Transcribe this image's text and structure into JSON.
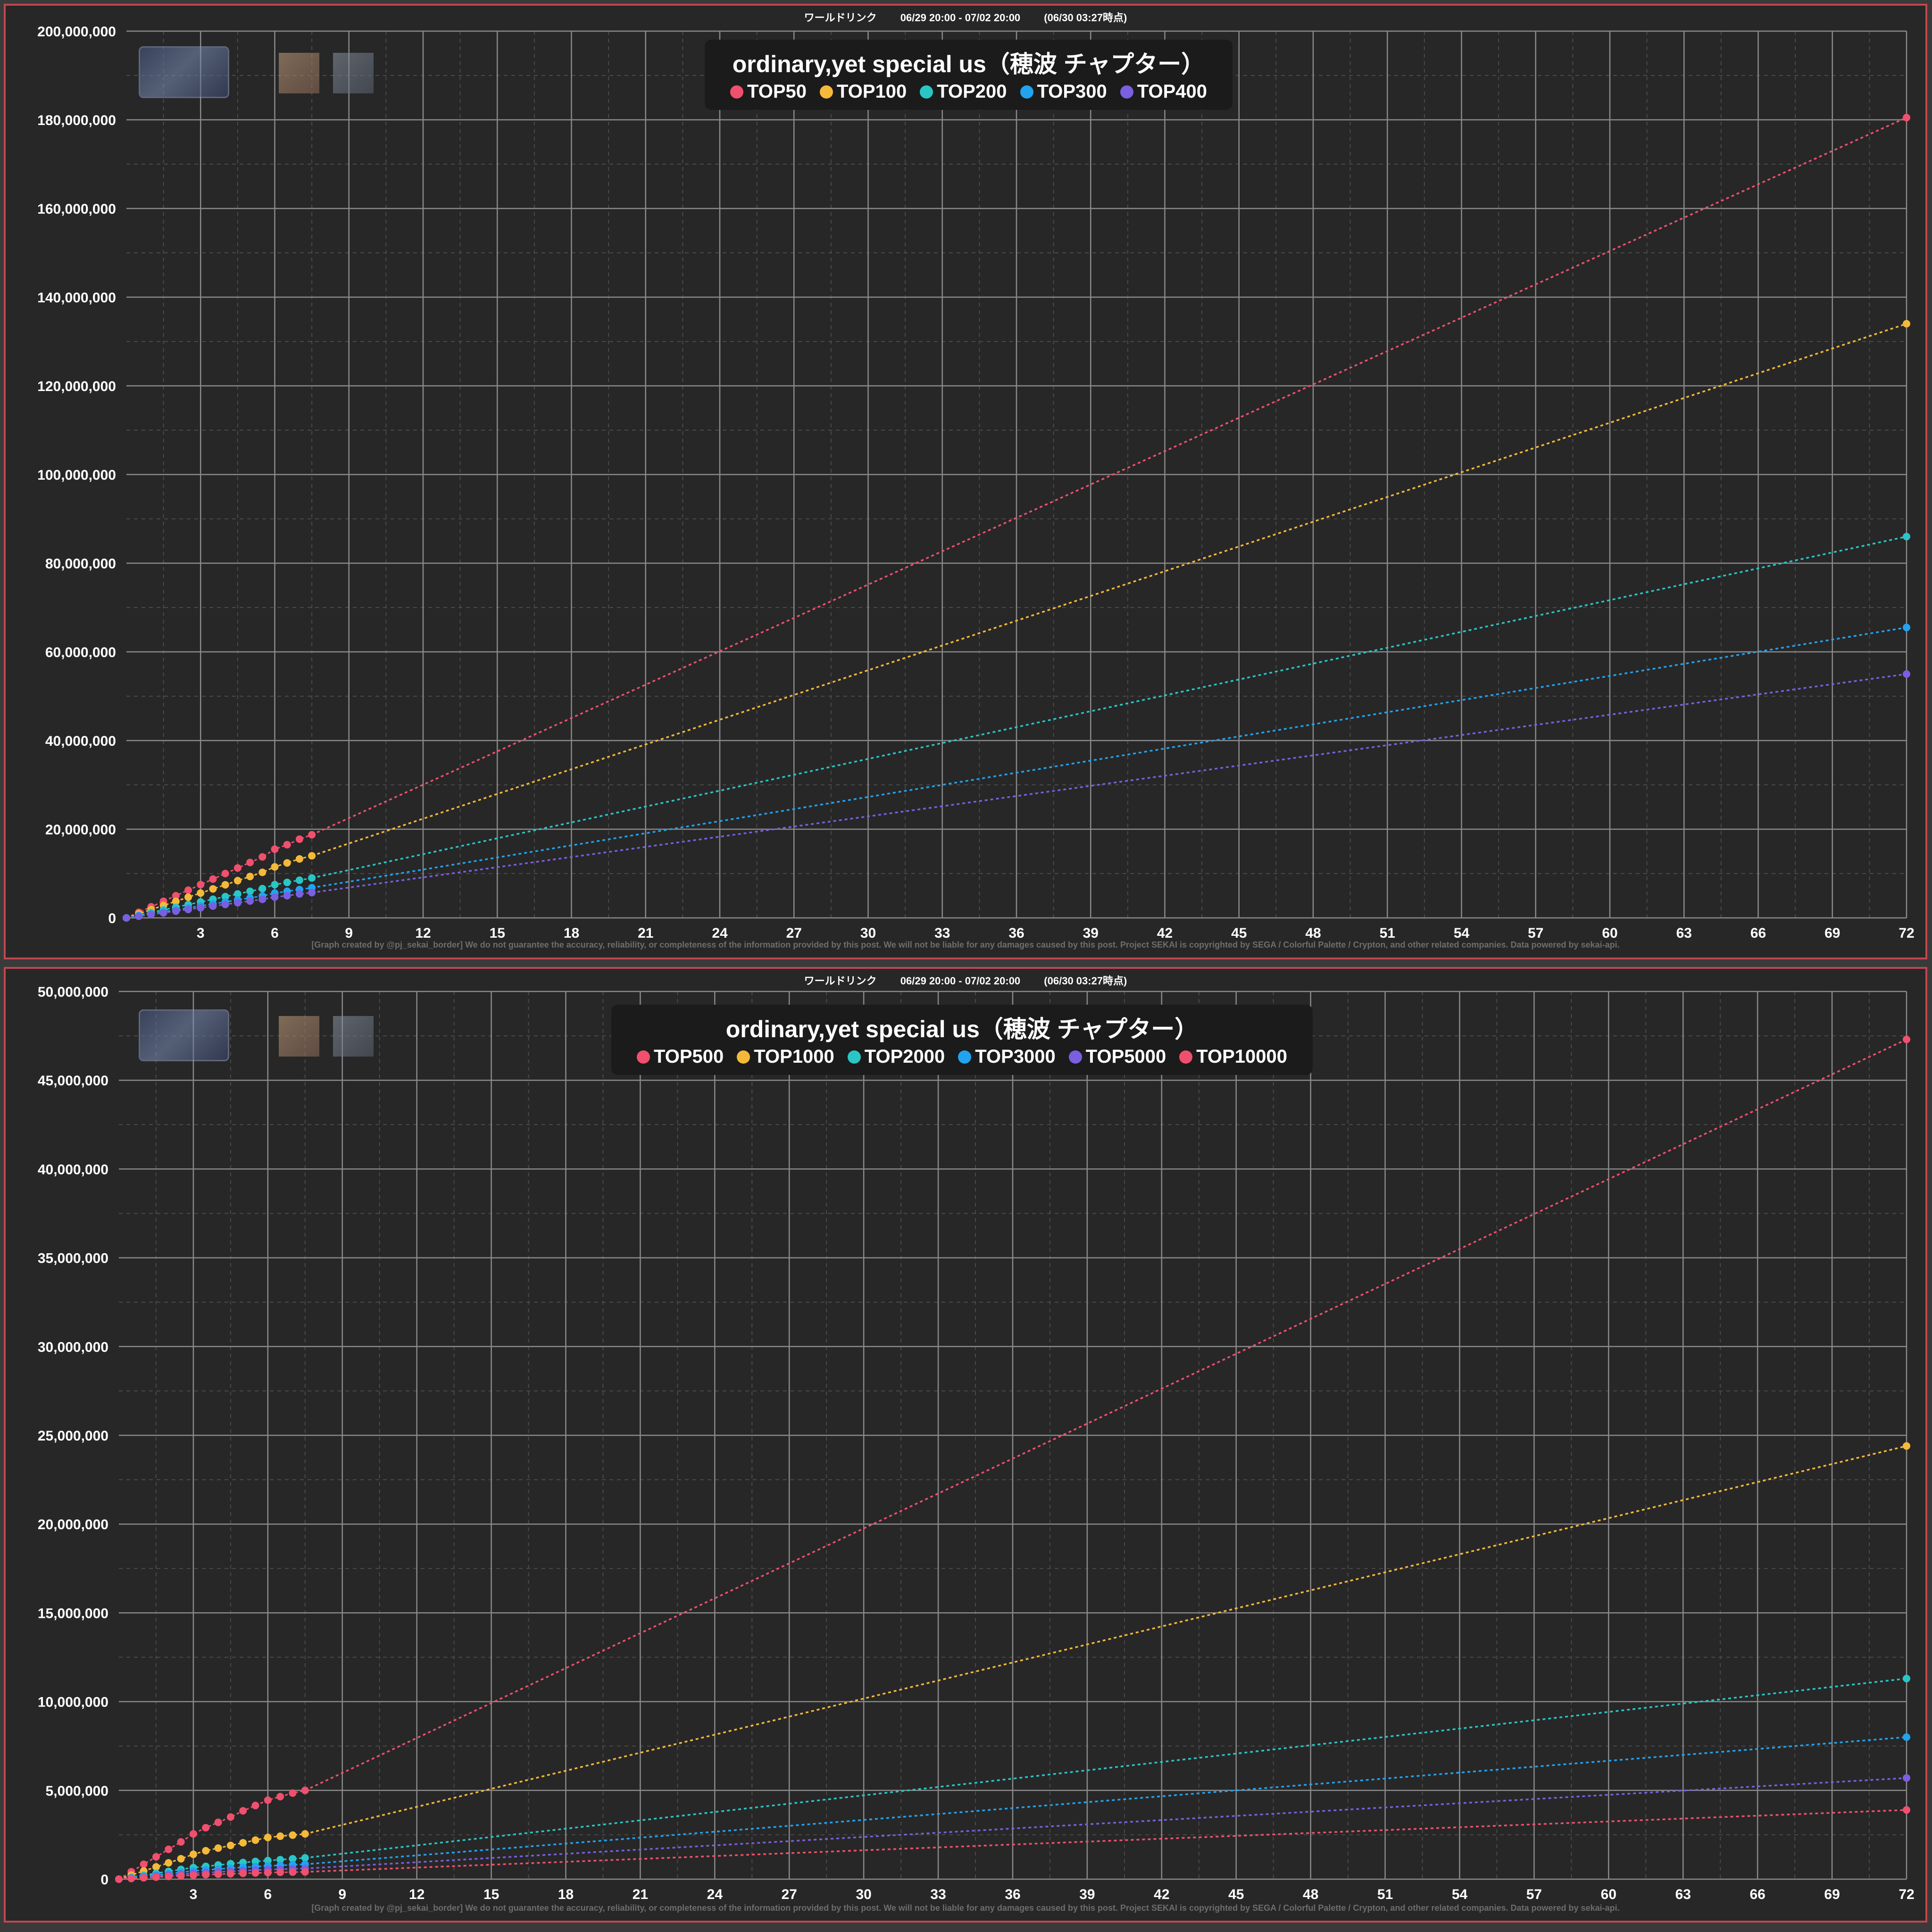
{
  "header": {
    "event": "ワールドリンク",
    "period": "06/29 20:00 - 07/02 20:00",
    "as_of": "(06/30 03:27時点)"
  },
  "footer": "[Graph created by @pj_sekai_border]  We do not guarantee the accuracy, reliability, or completeness of the information provided by this post. We will not be liable for any damages caused by this post. Project SEKAI is copyrighted by SEGA / Colorful Palette / Crypton, and other related companies. Data powered by sekai-api.",
  "colors": {
    "background": "#272727",
    "border": "#c0474f",
    "legend_bg": "#1b1b1b"
  },
  "chart_data": [
    {
      "type": "line",
      "title": "ordinary,yet special us（穂波 チャプター）",
      "xlabel": "",
      "ylabel": "",
      "xlim": [
        0,
        72
      ],
      "ylim": [
        0,
        200000000
      ],
      "x_ticks": [
        3,
        6,
        9,
        12,
        15,
        18,
        21,
        24,
        27,
        30,
        33,
        36,
        39,
        42,
        45,
        48,
        51,
        54,
        57,
        60,
        63,
        66,
        69,
        72
      ],
      "y_ticks": [
        0,
        20000000,
        40000000,
        60000000,
        80000000,
        100000000,
        120000000,
        140000000,
        160000000,
        180000000,
        200000000
      ],
      "grid": true,
      "legend_position": "top-center",
      "observed_x": [
        0,
        0.5,
        1,
        1.5,
        2,
        2.5,
        3,
        3.5,
        4,
        4.5,
        5,
        5.5,
        6,
        6.5,
        7,
        7.5
      ],
      "series": [
        {
          "name": "TOP50",
          "color": "#f0506e",
          "observed": [
            0,
            1250000,
            2500000,
            3750000,
            5000000,
            6250000,
            7500000,
            8750000,
            10000000,
            11250000,
            12500000,
            13750000,
            15500000,
            16500000,
            17750000,
            18750000
          ],
          "projection": 180500000
        },
        {
          "name": "TOP100",
          "color": "#f5b93a",
          "observed": [
            0,
            933333,
            1866667,
            2800000,
            3733333,
            4666667,
            5600000,
            6533333,
            7466667,
            8400000,
            9333333,
            10266667,
            11500000,
            12400000,
            13300000,
            14000000
          ],
          "projection": 134000000
        },
        {
          "name": "TOP200",
          "color": "#2ac6c6",
          "observed": [
            0,
            600000,
            1200000,
            1800000,
            2400000,
            3000000,
            3600000,
            4200000,
            4800000,
            5400000,
            6000000,
            6600000,
            7500000,
            8000000,
            8500000,
            9000000
          ],
          "projection": 86000000
        },
        {
          "name": "TOP300",
          "color": "#22a3f0",
          "observed": [
            0,
            450000,
            900000,
            1350000,
            1800000,
            2250000,
            2700000,
            3150000,
            3600000,
            4050000,
            4500000,
            4950000,
            5600000,
            6000000,
            6400000,
            6800000
          ],
          "projection": 65500000
        },
        {
          "name": "TOP400",
          "color": "#7a5fe0",
          "observed": [
            0,
            380000,
            760000,
            1140000,
            1520000,
            1900000,
            2280000,
            2660000,
            3040000,
            3420000,
            3800000,
            4180000,
            4700000,
            5000000,
            5400000,
            5700000
          ],
          "projection": 55000000
        }
      ]
    },
    {
      "type": "line",
      "title": "ordinary,yet special us（穂波 チャプター）",
      "xlabel": "",
      "ylabel": "",
      "xlim": [
        0,
        72
      ],
      "ylim": [
        0,
        50000000
      ],
      "x_ticks": [
        3,
        6,
        9,
        12,
        15,
        18,
        21,
        24,
        27,
        30,
        33,
        36,
        39,
        42,
        45,
        48,
        51,
        54,
        57,
        60,
        63,
        66,
        69,
        72
      ],
      "y_ticks": [
        0,
        5000000,
        10000000,
        15000000,
        20000000,
        25000000,
        30000000,
        35000000,
        40000000,
        45000000,
        50000000
      ],
      "grid": true,
      "legend_position": "top-center",
      "observed_x": [
        0,
        0.5,
        1,
        1.5,
        2,
        2.5,
        3,
        3.5,
        4,
        4.5,
        5,
        5.5,
        6,
        6.5,
        7,
        7.5
      ],
      "series": [
        {
          "name": "TOP500",
          "color": "#f0506e",
          "observed": [
            0,
            420000,
            840000,
            1260000,
            1680000,
            2100000,
            2550000,
            2900000,
            3200000,
            3500000,
            3850000,
            4150000,
            4450000,
            4650000,
            4850000,
            5000000
          ],
          "projection": 47300000
        },
        {
          "name": "TOP1000",
          "color": "#f5b93a",
          "observed": [
            0,
            230000,
            460000,
            690000,
            920000,
            1150000,
            1400000,
            1600000,
            1750000,
            1900000,
            2050000,
            2200000,
            2350000,
            2420000,
            2480000,
            2550000
          ],
          "projection": 24400000
        },
        {
          "name": "TOP2000",
          "color": "#2ac6c6",
          "observed": [
            0,
            110000,
            220000,
            330000,
            440000,
            550000,
            650000,
            720000,
            800000,
            870000,
            940000,
            1000000,
            1050000,
            1100000,
            1150000,
            1200000
          ],
          "projection": 11300000
        },
        {
          "name": "TOP3000",
          "color": "#22a3f0",
          "observed": [
            0,
            78000,
            156000,
            234000,
            312000,
            390000,
            460000,
            520000,
            570000,
            620000,
            670000,
            710000,
            750000,
            780000,
            810000,
            840000
          ],
          "projection": 8000000
        },
        {
          "name": "TOP5000",
          "color": "#7a5fe0",
          "observed": [
            0,
            56000,
            112000,
            168000,
            224000,
            280000,
            330000,
            370000,
            410000,
            445000,
            480000,
            510000,
            540000,
            560000,
            580000,
            600000
          ],
          "projection": 5700000
        },
        {
          "name": "TOP10000",
          "color": "#f0506e",
          "observed": [
            0,
            38000,
            76000,
            114000,
            152000,
            190000,
            225000,
            255000,
            280000,
            305000,
            330000,
            350000,
            370000,
            385000,
            398000,
            410000
          ],
          "projection": 3900000
        }
      ]
    }
  ]
}
